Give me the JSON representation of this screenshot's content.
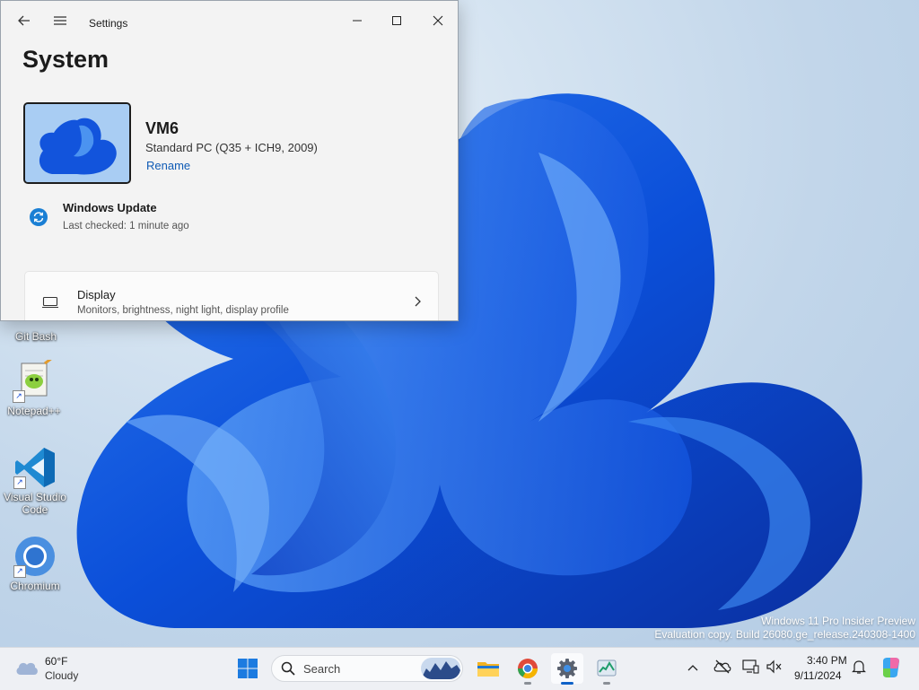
{
  "window": {
    "title": "Settings",
    "page_title": "System",
    "device": {
      "name": "VM6",
      "model": "Standard PC (Q35 + ICH9, 2009)",
      "rename_label": "Rename"
    },
    "windows_update": {
      "title": "Windows Update",
      "status": "Last checked: 1 minute ago"
    },
    "settings_items": [
      {
        "title": "Display",
        "description": "Monitors, brightness, night light, display profile"
      }
    ]
  },
  "desktop": {
    "icons": [
      {
        "label": "Git Bash"
      },
      {
        "label": "Notepad++"
      },
      {
        "label": "Visual Studio Code"
      },
      {
        "label": "Chromium"
      }
    ],
    "watermark": {
      "line1": "Windows 11 Pro Insider Preview",
      "line2": "Evaluation copy. Build 26080.ge_release.240308-1400"
    }
  },
  "taskbar": {
    "weather": {
      "temperature": "60°F",
      "condition": "Cloudy"
    },
    "search_placeholder": "Search",
    "pinned": [
      "start-icon",
      "file-explorer-icon",
      "chromium-icon",
      "settings-icon",
      "task-manager-icon"
    ],
    "clock": {
      "time": "3:40 PM",
      "date": "9/11/2024"
    }
  },
  "colors": {
    "accent": "#0f5bb5",
    "window_bg": "#f3f3f3",
    "taskbar_bg": "#eef0f4"
  }
}
